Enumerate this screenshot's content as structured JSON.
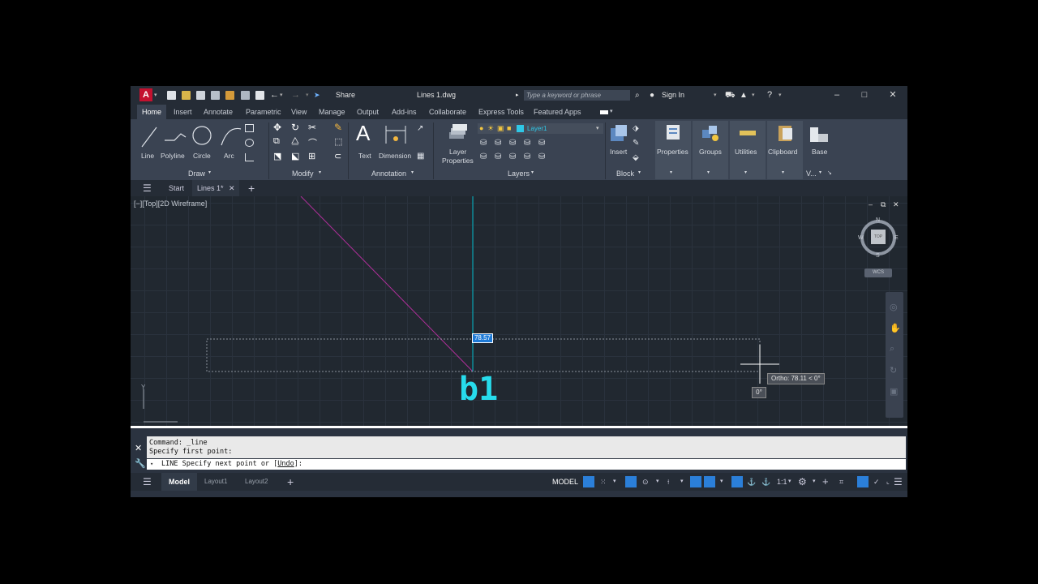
{
  "titlebar": {
    "app_letter": "A",
    "share_label": "Share",
    "file_name": "Lines 1.dwg",
    "search_placeholder": "Type a keyword or phrase",
    "sign_in_label": "Sign In"
  },
  "ribbon_tabs": [
    "Home",
    "Insert",
    "Annotate",
    "Parametric",
    "View",
    "Manage",
    "Output",
    "Add-ins",
    "Collaborate",
    "Express Tools",
    "Featured Apps"
  ],
  "ribbon": {
    "draw": {
      "title": "Draw",
      "tools": [
        "Line",
        "Polyline",
        "Circle",
        "Arc"
      ]
    },
    "modify": {
      "title": "Modify"
    },
    "annotation": {
      "title": "Annotation",
      "tools": [
        "Text",
        "Dimension"
      ]
    },
    "layers": {
      "title": "Layers",
      "layer_props_line1": "Layer",
      "layer_props_line2": "Properties",
      "current_layer": "Layer1",
      "layer_color": "#2fc7e6"
    },
    "block": {
      "title": "Block",
      "insert": "Insert"
    },
    "properties": "Properties",
    "groups": "Groups",
    "utilities": "Utilities",
    "clipboard": "Clipboard",
    "base": "Base",
    "view_short": "V..."
  },
  "doc_tabs": {
    "start": "Start",
    "active": "Lines 1*"
  },
  "viewport": {
    "label": "[−][Top][2D Wireframe]",
    "angle_value": "78.57",
    "ortho_tooltip": "Ortho: 78.11 < 0°",
    "angle_tooltip": "0°",
    "annotation_text": "b1",
    "compass": {
      "n": "N",
      "s": "S",
      "e": "E",
      "w": "W",
      "top": "TOP"
    },
    "ucs_label": "WCS",
    "ucs_y": "Y"
  },
  "command": {
    "history": [
      "Command: _line",
      "Specify first point:"
    ],
    "prompt_prefix": "LINE Specify next point or [",
    "prompt_option": "Undo",
    "prompt_suffix": "]:"
  },
  "status": {
    "model_tab": "Model",
    "layouts": [
      "Layout1",
      "Layout2"
    ],
    "model_space": "MODEL",
    "scale": "1:1"
  },
  "colors": {
    "accent": "#1e7ad6",
    "cad_cyan": "#27dcec",
    "magenta_line": "#b02f9a",
    "cursor_cyan": "#00b8c8"
  }
}
